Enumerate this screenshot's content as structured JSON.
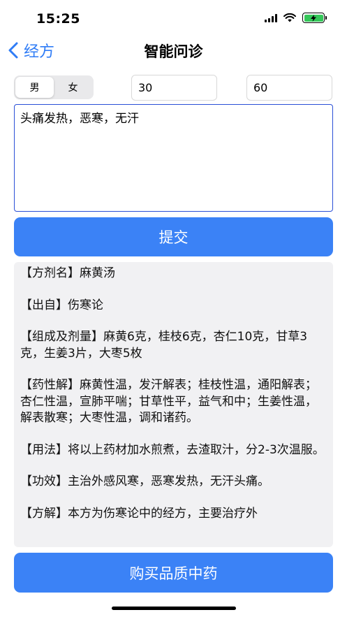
{
  "status_bar": {
    "time": "15:25"
  },
  "nav": {
    "back_label": "经方",
    "title": "智能问诊"
  },
  "form": {
    "gender_options": [
      "男",
      "女"
    ],
    "selected_gender": "男",
    "age_value": "30",
    "weight_value": "60",
    "symptoms": "头痛发热，恶寒，无汗",
    "submit_label": "提交"
  },
  "result": {
    "paragraphs": [
      "【方剂名】麻黄汤",
      "【出自】伤寒论",
      "【组成及剂量】麻黄6克，桂枝6克，杏仁10克，甘草3克，生姜3片，大枣5枚",
      "【药性解】麻黄性温，发汗解表；桂枝性温，通阳解表；杏仁性温，宣肺平喘；甘草性平，益气和中；生姜性温，解表散寒；大枣性温，调和诸药。",
      "【用法】将以上药材加水煎煮，去渣取汁，分2-3次温服。",
      "【功效】主治外感风寒，恶寒发热，无汗头痛。",
      "【方解】本方为伤寒论中的经方，主要治疗外"
    ]
  },
  "buy_label": "购买品质中药",
  "colors": {
    "accent": "#3b82f6",
    "back_link": "#2f7cf6",
    "battery": "#34c759"
  }
}
